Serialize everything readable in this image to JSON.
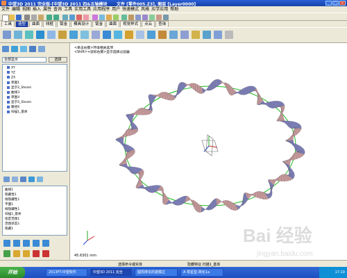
{
  "window": {
    "title": "中望3D 2011 完全版-[中望3D 2011 四&五轴模块",
    "file_info": "文件 [零件005.Z3], 图层 [Layer0000]"
  },
  "menu": [
    "文件",
    "编辑",
    "视图",
    "插入",
    "属性",
    "查询",
    "工具",
    "实用工具",
    "应用程序",
    "用户",
    "快速模式",
    "风格",
    "应学应用",
    "帮助"
  ],
  "tabs": [
    "工具",
    "造型",
    "曲面",
    "线框",
    "钣金",
    "模具设计",
    "钣金",
    "曲面",
    "视觉样式",
    "点云",
    "查询"
  ],
  "left_panel": {
    "filter_value": "全部显示",
    "filter_button": "选择",
    "tree_items": [
      "XY",
      "YZ",
      "ZX",
      "草图1",
      "显示2_Steam",
      "曲线3",
      "草图4",
      "显示5_Steam",
      "路径6",
      "扫描1_基体"
    ],
    "props": [
      "曲线1",
      "隐藏性1",
      "线隐藏性1",
      "平面1",
      "线隐藏性1",
      "扫描1_基体",
      "指定范围1",
      "范围状态1",
      "隐藏1"
    ]
  },
  "viewport": {
    "hint_line1": "<单击右键>环境相关选项",
    "hint_line2": "<Shift>+鼠标右键>显示选择过滤器",
    "coordinate": "45.6301 mm",
    "colors": {
      "ribbon_outer": "#7d7fb9",
      "ribbon_inner": "#c89a9c",
      "ellipse": "#22bb22"
    }
  },
  "statusbar": {
    "prompt": "选择命令或实体",
    "middle": "隐藏特征  扫描1_基体"
  },
  "taskbar": {
    "start": "开始",
    "items": [
      "2013FT-中望软件",
      "中望3D 2011 完全",
      "圆周排花的建模过",
      "A  草星型-简化1a"
    ],
    "clock": "17:10"
  },
  "watermark": {
    "text": "Bai 经验",
    "url": "jingyan.baidu.com"
  }
}
